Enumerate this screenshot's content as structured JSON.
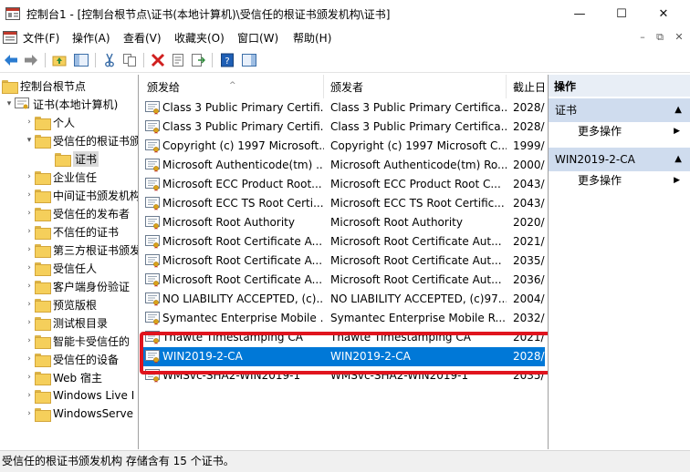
{
  "window": {
    "title": "控制台1 - [控制台根节点\\证书(本地计算机)\\受信任的根证书颁发机构\\证书]",
    "minimize": "—",
    "maximize": "☐",
    "close": "✕"
  },
  "menubar": {
    "items": [
      "文件(F)",
      "操作(A)",
      "查看(V)",
      "收藏夹(O)",
      "窗口(W)",
      "帮助(H)"
    ],
    "mdi_minimize": "–",
    "mdi_restore": "⧉",
    "mdi_close": "✕"
  },
  "tree": {
    "items": [
      {
        "label": "控制台根节点",
        "arrow": ""
      },
      {
        "label": "证书(本地计算机)",
        "arrow": "▾"
      },
      {
        "label": "个人",
        "arrow": "›"
      },
      {
        "label": "受信任的根证书颁",
        "arrow": "▾"
      },
      {
        "label": "证书",
        "arrow": ""
      },
      {
        "label": "企业信任",
        "arrow": "›"
      },
      {
        "label": "中间证书颁发机构",
        "arrow": "›"
      },
      {
        "label": "受信任的发布者",
        "arrow": "›"
      },
      {
        "label": "不信任的证书",
        "arrow": "›"
      },
      {
        "label": "第三方根证书颁发",
        "arrow": "›"
      },
      {
        "label": "受信任人",
        "arrow": "›"
      },
      {
        "label": "客户端身份验证",
        "arrow": "›"
      },
      {
        "label": "预览版根",
        "arrow": "›"
      },
      {
        "label": "测试根目录",
        "arrow": "›"
      },
      {
        "label": "智能卡受信任的",
        "arrow": "›"
      },
      {
        "label": "受信任的设备",
        "arrow": "›"
      },
      {
        "label": "Web 宿主",
        "arrow": "›"
      },
      {
        "label": "Windows Live I",
        "arrow": "›"
      },
      {
        "label": "WindowsServe",
        "arrow": "›"
      }
    ]
  },
  "list": {
    "columns": [
      "颁发给",
      "颁发者",
      "截止日"
    ],
    "sort_indicator": "^",
    "rows": [
      {
        "issued_to": "Class 3 Public Primary Certifi...",
        "issued_by": "Class 3 Public Primary Certifica...",
        "expires": "2028/"
      },
      {
        "issued_to": "Class 3 Public Primary Certifi...",
        "issued_by": "Class 3 Public Primary Certifica...",
        "expires": "2028/"
      },
      {
        "issued_to": "Copyright (c) 1997 Microsoft...",
        "issued_by": "Copyright (c) 1997 Microsoft C...",
        "expires": "1999/"
      },
      {
        "issued_to": "Microsoft Authenticode(tm) ...",
        "issued_by": "Microsoft Authenticode(tm) Ro...",
        "expires": "2000/"
      },
      {
        "issued_to": "Microsoft ECC Product Root...",
        "issued_by": "Microsoft ECC Product Root C...",
        "expires": "2043/"
      },
      {
        "issued_to": "Microsoft ECC TS Root Certi...",
        "issued_by": "Microsoft ECC TS Root Certific...",
        "expires": "2043/"
      },
      {
        "issued_to": "Microsoft Root Authority",
        "issued_by": "Microsoft Root Authority",
        "expires": "2020/"
      },
      {
        "issued_to": "Microsoft Root Certificate A...",
        "issued_by": "Microsoft Root Certificate Aut...",
        "expires": "2021/"
      },
      {
        "issued_to": "Microsoft Root Certificate A...",
        "issued_by": "Microsoft Root Certificate Aut...",
        "expires": "2035/"
      },
      {
        "issued_to": "Microsoft Root Certificate A...",
        "issued_by": "Microsoft Root Certificate Aut...",
        "expires": "2036/"
      },
      {
        "issued_to": "NO LIABILITY ACCEPTED, (c)...",
        "issued_by": "NO LIABILITY ACCEPTED, (c)97...",
        "expires": "2004/"
      },
      {
        "issued_to": "Symantec Enterprise Mobile ...",
        "issued_by": "Symantec Enterprise Mobile R...",
        "expires": "2032/"
      },
      {
        "issued_to": "Thawte Timestamping CA",
        "issued_by": "Thawte Timestamping CA",
        "expires": "2021/"
      },
      {
        "issued_to": "WIN2019-2-CA",
        "issued_by": "WIN2019-2-CA",
        "expires": "2028/"
      },
      {
        "issued_to": "WMSvc-SHA2-WIN2019-1",
        "issued_by": "WMSvc-SHA2-WIN2019-1",
        "expires": "2035/"
      }
    ]
  },
  "actions": {
    "title": "操作",
    "sections": [
      {
        "label": "证书",
        "item": "更多操作"
      },
      {
        "label": "WIN2019-2-CA",
        "item": "更多操作"
      }
    ]
  },
  "status": {
    "text": "受信任的根证书颁发机构 存储含有 15 个证书。"
  },
  "colors": {
    "selection": "#0078d7",
    "highlight_box": "#e0141e",
    "action_section": "#cfdcee"
  }
}
